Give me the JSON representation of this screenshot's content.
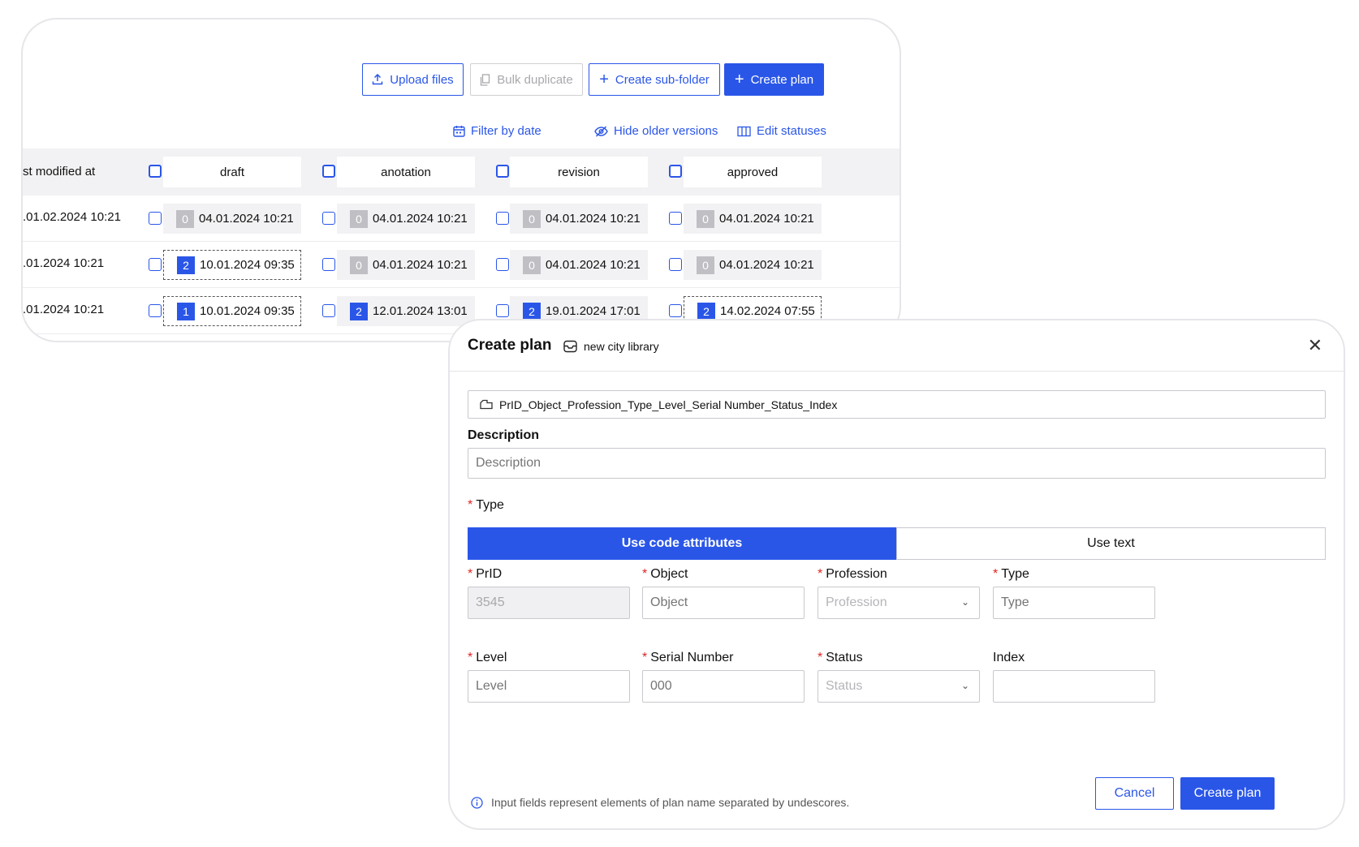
{
  "toolbar": {
    "upload_label": "Upload files",
    "bulk_label": "Bulk duplicate",
    "subfolder_label": "Create sub-folder",
    "create_plan_label": "Create plan"
  },
  "filters": {
    "filter_date": "Filter by date",
    "hide_older": "Hide older versions",
    "edit_statuses": "Edit statuses"
  },
  "table": {
    "modified_header": "st modified at",
    "statuses": [
      "draft",
      "anotation",
      "revision",
      "approved"
    ],
    "rows": [
      {
        "modified": ".01.02.2024 10:21",
        "cells": [
          {
            "badge": "0",
            "date": "04.01.2024 10:21"
          },
          {
            "badge": "0",
            "date": "04.01.2024 10:21"
          },
          {
            "badge": "0",
            "date": "04.01.2024 10:21"
          },
          {
            "badge": "0",
            "date": "04.01.2024 10:21"
          }
        ]
      },
      {
        "modified": ".01.2024 10:21",
        "cells": [
          {
            "badge": "2",
            "date": "10.01.2024 09:35"
          },
          {
            "badge": "0",
            "date": "04.01.2024 10:21"
          },
          {
            "badge": "0",
            "date": "04.01.2024 10:21"
          },
          {
            "badge": "0",
            "date": "04.01.2024 10:21"
          }
        ]
      },
      {
        "modified": ".01.2024 10:21",
        "cells": [
          {
            "badge": "1",
            "date": "10.01.2024 09:35"
          },
          {
            "badge": "2",
            "date": "12.01.2024 13:01"
          },
          {
            "badge": "2",
            "date": "19.01.2024 17:01"
          },
          {
            "badge": "2",
            "date": "14.02.2024 07:55"
          }
        ]
      }
    ]
  },
  "modal": {
    "title": "Create plan",
    "folder": "new city library",
    "name_pattern": "PrID_Object_Profession_Type_Level_Serial Number_Status_Index",
    "description_label": "Description",
    "description_placeholder": "Description",
    "type_label": "Type",
    "type_options": [
      "Use code attributes",
      "Use text"
    ],
    "fields": {
      "prid": {
        "label": "PrID",
        "value": "3545"
      },
      "object": {
        "label": "Object",
        "placeholder": "Object"
      },
      "profession": {
        "label": "Profession",
        "placeholder": "Profession"
      },
      "type": {
        "label": "Type",
        "placeholder": "Type"
      },
      "level": {
        "label": "Level",
        "placeholder": "Level"
      },
      "serial": {
        "label": "Serial Number",
        "placeholder": "000"
      },
      "status": {
        "label": "Status",
        "placeholder": "Status"
      },
      "index": {
        "label": "Index",
        "placeholder": ""
      }
    },
    "hint": "Input fields represent elements of plan name separated by undescores.",
    "cancel_label": "Cancel",
    "submit_label": "Create plan"
  },
  "colors": {
    "accent": "#2a56e8",
    "required": "#e02424"
  }
}
